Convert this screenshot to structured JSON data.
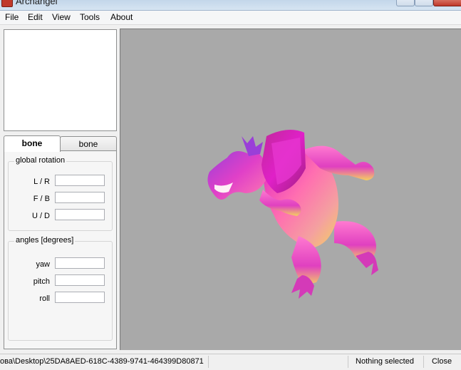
{
  "window": {
    "title": "Archangel"
  },
  "menu": {
    "file": "File",
    "edit": "Edit",
    "view": "View",
    "tools": "Tools",
    "about": "About"
  },
  "tabs": [
    {
      "label": "bone"
    },
    {
      "label": "bone"
    }
  ],
  "global_rotation": {
    "title": "global rotation",
    "fields": [
      {
        "label": "L / R",
        "value": ""
      },
      {
        "label": "F / B",
        "value": ""
      },
      {
        "label": "U / D",
        "value": ""
      }
    ]
  },
  "angles": {
    "title": "angles [degrees]",
    "fields": [
      {
        "label": "yaw",
        "value": ""
      },
      {
        "label": "pitch",
        "value": ""
      },
      {
        "label": "roll",
        "value": ""
      }
    ]
  },
  "status": {
    "path": "ова\\Desktop\\25DA8AED-618C-4389-9741-464399D80871",
    "selection": "Nothing selected",
    "close": "Close"
  },
  "colors": {
    "viewport_bg": "#a9a9a9",
    "model_magenta": "#e020c8",
    "model_pink": "#ff6fb0",
    "model_yellow": "#f4d060",
    "model_purple": "#9a3fd8"
  }
}
